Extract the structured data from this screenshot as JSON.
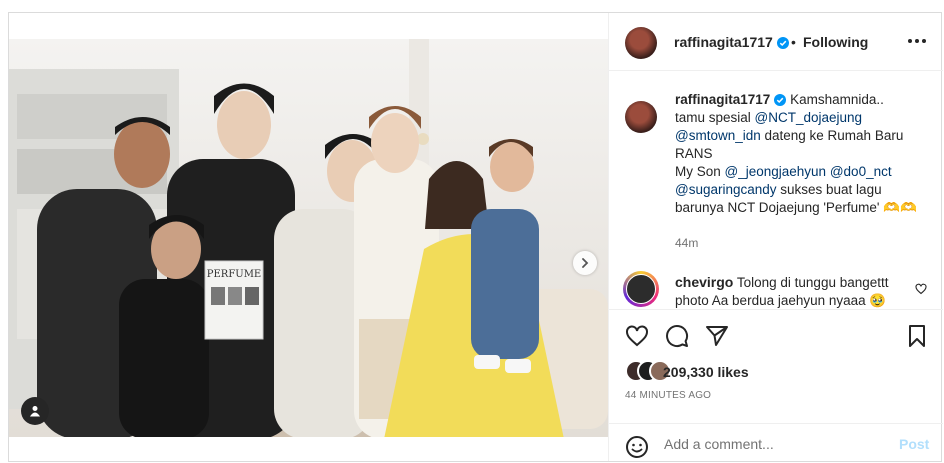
{
  "post": {
    "author": "raffinagita1717",
    "follow_separator": "•",
    "follow_status": "Following",
    "caption": {
      "author": "raffinagita1717",
      "line1": "Kamshamnida..",
      "line2_prefix": "tamu spesial ",
      "mention_dojaejung": "@NCT_dojaejung",
      "mention_smtown": "@smtown_idn",
      "line3_suffix": " dateng ke Rumah Baru",
      "line4": "RANS",
      "line5_prefix": "My Son ",
      "mention_jeongjaehyun": "@_jeongjaehyun",
      "mention_do0nct": "@do0_nct",
      "mention_sugaring": "@sugaringcandy",
      "line6_suffix": " sukses buat lagu",
      "line7": "barunya NCT Dojaejung 'Perfume' 🫶🫶",
      "time": "44m"
    },
    "comment": {
      "author": "chevirgo",
      "text": "Tolong di tunggu bangettt photo Aa berdua jaehyun nyaaa 🥹"
    },
    "likes": "209,330 likes",
    "posted_ago": "44 MINUTES AGO",
    "comment_placeholder": "Add a comment...",
    "post_label": "Post",
    "album_text": "PERFUME",
    "carousel": {
      "count": 8,
      "active_index": 0
    }
  },
  "colors": {
    "link": "#00376b",
    "verified": "#0095f6",
    "post_disabled": "#b2dffc",
    "muted": "#737373"
  },
  "icons": [
    "verified-badge-icon",
    "more-options-icon",
    "heart-icon",
    "comment-icon",
    "share-icon",
    "bookmark-icon",
    "emoji-icon",
    "chevron-right-icon",
    "user-tag-icon"
  ]
}
